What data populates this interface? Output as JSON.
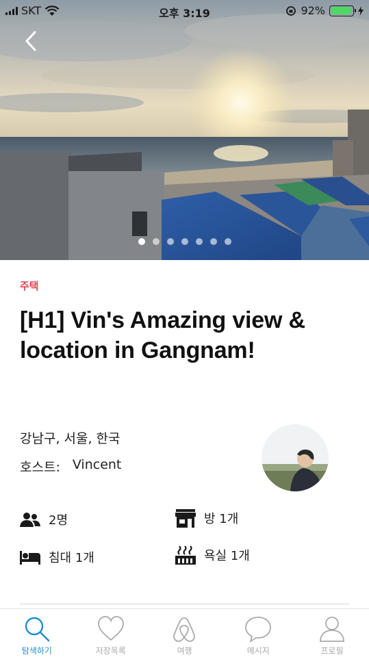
{
  "status_bar": {
    "carrier": "SKT",
    "time": "오후 3:19",
    "battery": "92%"
  },
  "listing": {
    "category": "주택",
    "title": "[H1] Vin's Amazing view & location in Gangnam!",
    "location": "강남구, 서울, 한국",
    "host_label": "호스트:",
    "host_name": "Vincent"
  },
  "carousel": {
    "total": 7,
    "active_index": 0
  },
  "amenities": {
    "guests": "2명",
    "rooms": "방 1개",
    "beds": "침대 1개",
    "baths": "욕실 1개"
  },
  "tabs": [
    {
      "label": "탐색하기",
      "icon": "search-icon",
      "active": true
    },
    {
      "label": "저장목록",
      "icon": "heart-icon",
      "active": false
    },
    {
      "label": "여행",
      "icon": "airbnb-logo-icon",
      "active": false
    },
    {
      "label": "메시지",
      "icon": "chat-bubble-icon",
      "active": false
    },
    {
      "label": "프로필",
      "icon": "profile-icon",
      "active": false
    }
  ],
  "colors": {
    "accent": "#e0454f",
    "tab_active": "#1b8fcf",
    "tab_inactive": "#a9a9a9",
    "battery_fill": "#4cd964"
  }
}
